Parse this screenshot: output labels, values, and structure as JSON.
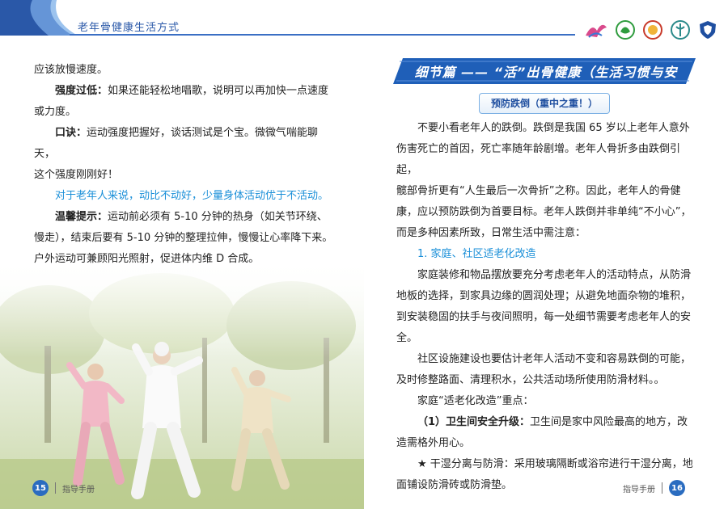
{
  "header": {
    "title": "老年骨健康生活方式"
  },
  "left": {
    "lines": [
      {
        "text": "应该放慢速度。",
        "style": "plain"
      },
      {
        "label": "强度过低：",
        "text": "如果还能轻松地唱歌，说明可以再加快一点速度",
        "style": "labeled-indent"
      },
      {
        "text": "或力度。",
        "style": "plain"
      },
      {
        "label": "口诀：",
        "text": "运动强度把握好，谈话测试是个宝。微微气喘能聊天，",
        "style": "labeled-indent"
      },
      {
        "text": "这个强度刚刚好！",
        "style": "plain"
      },
      {
        "text": "对于老年人来说，动比不动好，少量身体活动优于不活动。",
        "style": "blue-indent"
      },
      {
        "label": "温馨提示：",
        "text": "运动前必须有 5-10 分钟的热身（如关节环绕、",
        "style": "labeled-indent"
      },
      {
        "text": "慢走），结束后要有 5-10 分钟的整理拉伸，慢慢让心率降下来。",
        "style": "plain"
      },
      {
        "text": "户外运动可兼顾阳光照射，促进体内维 D 合成。",
        "style": "plain"
      }
    ]
  },
  "right": {
    "banner": "细节篇 —— “活”出骨健康（生活习惯与安全）",
    "subhead": "预防跌倒（重中之重！）",
    "lines": [
      {
        "text": "不要小看老年人的跌倒。跌倒是我国 65 岁以上老年人意外",
        "style": "indent"
      },
      {
        "text": "伤害死亡的首因，死亡率随年龄剧增。老年人骨折多由跌倒引起，",
        "style": "plain"
      },
      {
        "text": "髋部骨折更有“人生最后一次骨折”之称。因此，老年人的骨健",
        "style": "plain"
      },
      {
        "text": "康，应以预防跌倒为首要目标。老年人跌倒并非单纯“不小心”，",
        "style": "plain"
      },
      {
        "text": "而是多种因素所致，日常生活中需注意：",
        "style": "plain"
      },
      {
        "text": "1. 家庭、社区适老化改造",
        "style": "blue-indent"
      },
      {
        "text": "家庭装修和物品摆放要充分考虑老年人的活动特点，从防滑",
        "style": "indent"
      },
      {
        "text": "地板的选择，到家具边缘的圆润处理；从避免地面杂物的堆积，",
        "style": "plain"
      },
      {
        "text": "到安装稳固的扶手与夜间照明，每一处细节需要考虑老年人的安",
        "style": "plain"
      },
      {
        "text": "全。",
        "style": "plain"
      },
      {
        "text": "社区设施建设也要估计老年人活动不变和容易跌倒的可能，",
        "style": "indent"
      },
      {
        "text": "及时修整路面、清理积水，公共活动场所使用防滑材料。。",
        "style": "plain"
      },
      {
        "text": "家庭“适老化改造”重点：",
        "style": "indent"
      },
      {
        "label": "（1）卫生间安全升级：",
        "text": "卫生间是家中风险最高的地方，改",
        "style": "labeled-indent"
      },
      {
        "text": "造需格外用心。",
        "style": "plain"
      },
      {
        "text": "★ 干湿分离与防滑：采用玻璃隔断或浴帘进行干湿分离，地",
        "style": "indent"
      },
      {
        "text": "面铺设防滑砖或防滑垫。",
        "style": "plain"
      }
    ]
  },
  "footer": {
    "left_page_number": "15",
    "left_label": "指导手册",
    "right_label": "指导手册",
    "right_page_number": "16"
  },
  "colors": {
    "accent": "#2a6cc0",
    "highlight": "#1a8fd8",
    "banner": "#1f5fb8"
  }
}
